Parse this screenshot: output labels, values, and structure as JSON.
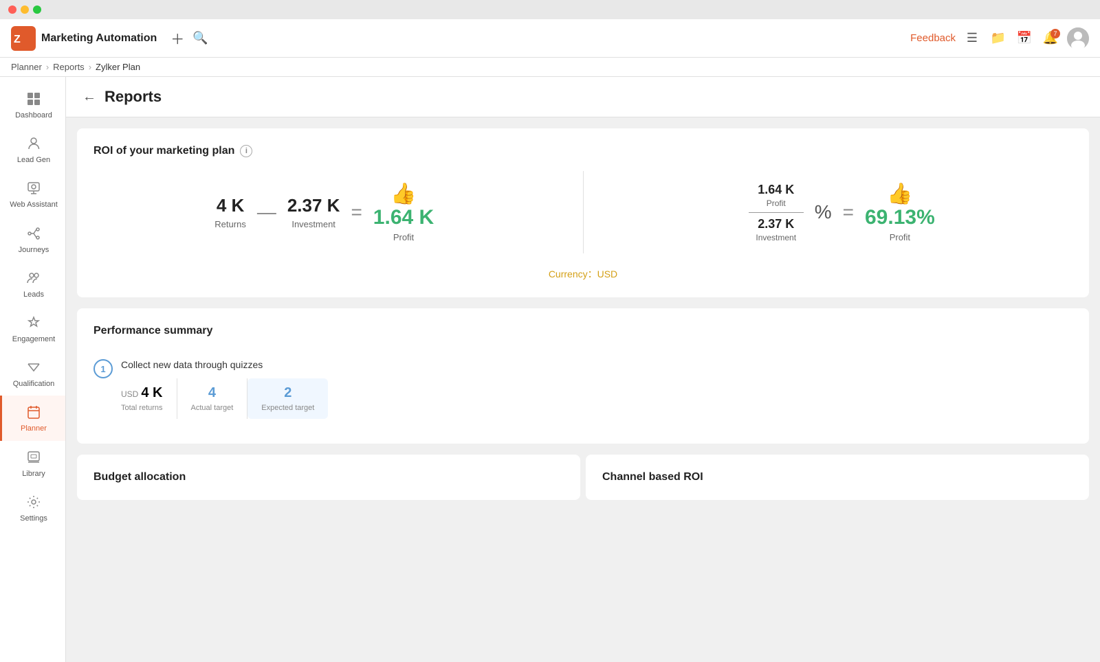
{
  "window": {
    "chrome_dots": [
      "red",
      "yellow",
      "green"
    ]
  },
  "topbar": {
    "app_name": "Marketing Automation",
    "feedback_label": "Feedback",
    "plus_tooltip": "Add",
    "search_tooltip": "Search",
    "notif_count": "7"
  },
  "breadcrumb": {
    "items": [
      "Planner",
      "Reports",
      "Zylker Plan"
    ]
  },
  "sidebar": {
    "items": [
      {
        "id": "dashboard",
        "label": "Dashboard",
        "icon": "⊞"
      },
      {
        "id": "lead-gen",
        "label": "Lead Gen",
        "icon": "👤"
      },
      {
        "id": "web-assistant",
        "label": "Web Assistant",
        "icon": "🤖"
      },
      {
        "id": "journeys",
        "label": "Journeys",
        "icon": "⚡"
      },
      {
        "id": "leads",
        "label": "Leads",
        "icon": "👥"
      },
      {
        "id": "engagement",
        "label": "Engagement",
        "icon": "✦"
      },
      {
        "id": "qualification",
        "label": "Qualification",
        "icon": "▽"
      },
      {
        "id": "planner",
        "label": "Planner",
        "icon": "📋",
        "active": true
      },
      {
        "id": "library",
        "label": "Library",
        "icon": "🖼"
      },
      {
        "id": "settings",
        "label": "Settings",
        "icon": "⚙"
      }
    ]
  },
  "page": {
    "title": "Reports",
    "back_label": "←"
  },
  "roi_section": {
    "title": "ROI of your marketing plan",
    "returns_value": "4 K",
    "returns_label": "Returns",
    "investment_value": "2.37 K",
    "investment_label": "Investment",
    "profit_value": "1.64 K",
    "profit_label": "Profit",
    "profit_numerator": "1.64 K",
    "profit_numerator_label": "Profit",
    "profit_denominator": "2.37 K",
    "profit_denominator_label": "Investment",
    "profit_pct": "69.13%",
    "profit_pct_label": "Profit",
    "currency_note": "Currency：USD",
    "op_minus": "—",
    "op_equals1": "=",
    "op_percent": "%",
    "op_equals2": "="
  },
  "performance_summary": {
    "title": "Performance summary",
    "items": [
      {
        "step": "1",
        "name": "Collect new data through quizzes",
        "total_returns_currency": "USD",
        "total_returns_value": "4 K",
        "total_returns_label": "Total returns",
        "actual_target_value": "4",
        "actual_target_label": "Actual target",
        "expected_target_value": "2",
        "expected_target_label": "Expected target"
      }
    ]
  },
  "bottom_sections": {
    "budget_title": "Budget allocation",
    "channel_title": "Channel based ROI"
  }
}
